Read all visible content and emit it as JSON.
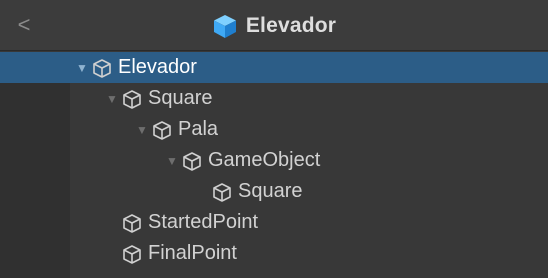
{
  "header": {
    "back_glyph": "<",
    "title": "Elevador",
    "title_icon": "prefab-cube-icon"
  },
  "colors": {
    "panel_bg": "#383838",
    "header_bg": "#3c3c3c",
    "selection_bg": "#2c5d87",
    "prefab_blue": "#3fa9f5"
  },
  "hierarchy": {
    "items": [
      {
        "label": "Elevador",
        "depth": 0,
        "expanded": true,
        "selected": true
      },
      {
        "label": "Square",
        "depth": 1,
        "expanded": true,
        "selected": false
      },
      {
        "label": "Pala",
        "depth": 2,
        "expanded": true,
        "selected": false
      },
      {
        "label": "GameObject",
        "depth": 3,
        "expanded": true,
        "selected": false
      },
      {
        "label": "Square",
        "depth": 4,
        "expanded": false,
        "selected": false
      },
      {
        "label": "StartedPoint",
        "depth": 1,
        "expanded": false,
        "selected": false
      },
      {
        "label": "FinalPoint",
        "depth": 1,
        "expanded": false,
        "selected": false
      }
    ]
  }
}
